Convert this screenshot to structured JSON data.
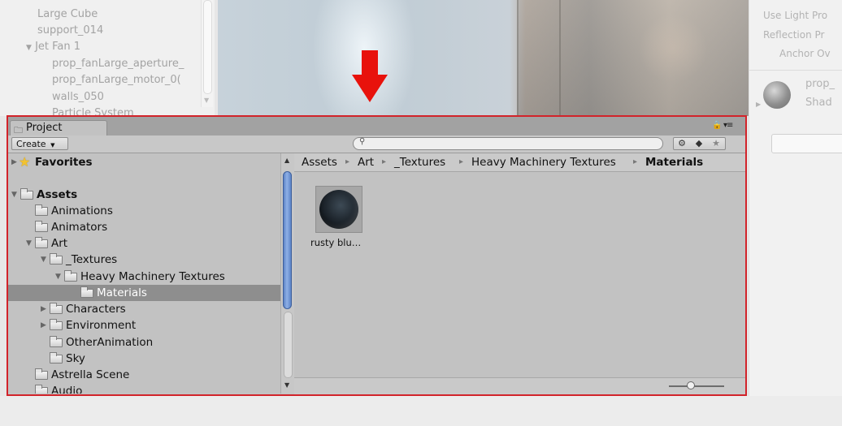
{
  "hierarchy": {
    "rows": [
      "Large Cube",
      "support_014",
      "Jet Fan 1",
      "prop_fanLarge_aperture_",
      "prop_fanLarge_motor_0(",
      "walls_050",
      "Particle System"
    ]
  },
  "inspector": {
    "use_light_probes": "Use Light Pro",
    "reflection_probes": "Reflection Pr",
    "anchor_override": "Anchor Ov",
    "material_name": "prop_",
    "shader_label": "Shad"
  },
  "project": {
    "tab_label": "Project",
    "create_label": "Create",
    "search": {
      "value": "",
      "placeholder": ""
    },
    "icons": {
      "lock": "lock-icon",
      "menu": "menu-icon",
      "type_filter": "type-filter-icon",
      "label_filter": "label-filter-icon",
      "favorite": "star-icon"
    },
    "tree": [
      {
        "label": "Favorites",
        "bold": true,
        "expanded": false
      },
      {
        "label": "Assets",
        "bold": true,
        "expanded": true
      },
      {
        "label": "Animations"
      },
      {
        "label": "Animators"
      },
      {
        "label": "Art",
        "expanded": true
      },
      {
        "label": "_Textures",
        "expanded": true
      },
      {
        "label": "Heavy Machinery Textures",
        "expanded": true
      },
      {
        "label": "Materials",
        "selected": true
      },
      {
        "label": "Characters",
        "expanded": false
      },
      {
        "label": "Environment",
        "expanded": false
      },
      {
        "label": "OtherAnimation"
      },
      {
        "label": "Sky"
      },
      {
        "label": "Astrella Scene"
      },
      {
        "label": "Audio"
      }
    ],
    "breadcrumb": [
      "Assets",
      "Art",
      "_Textures",
      "Heavy Machinery Textures",
      "Materials"
    ],
    "assets": [
      {
        "label": "rusty blu…"
      }
    ]
  },
  "colors": {
    "highlight_border": "#d2232a",
    "arrow": "#e8120c",
    "selection": "#8e8e8e",
    "scroll_thumb": "#5c83c7"
  }
}
